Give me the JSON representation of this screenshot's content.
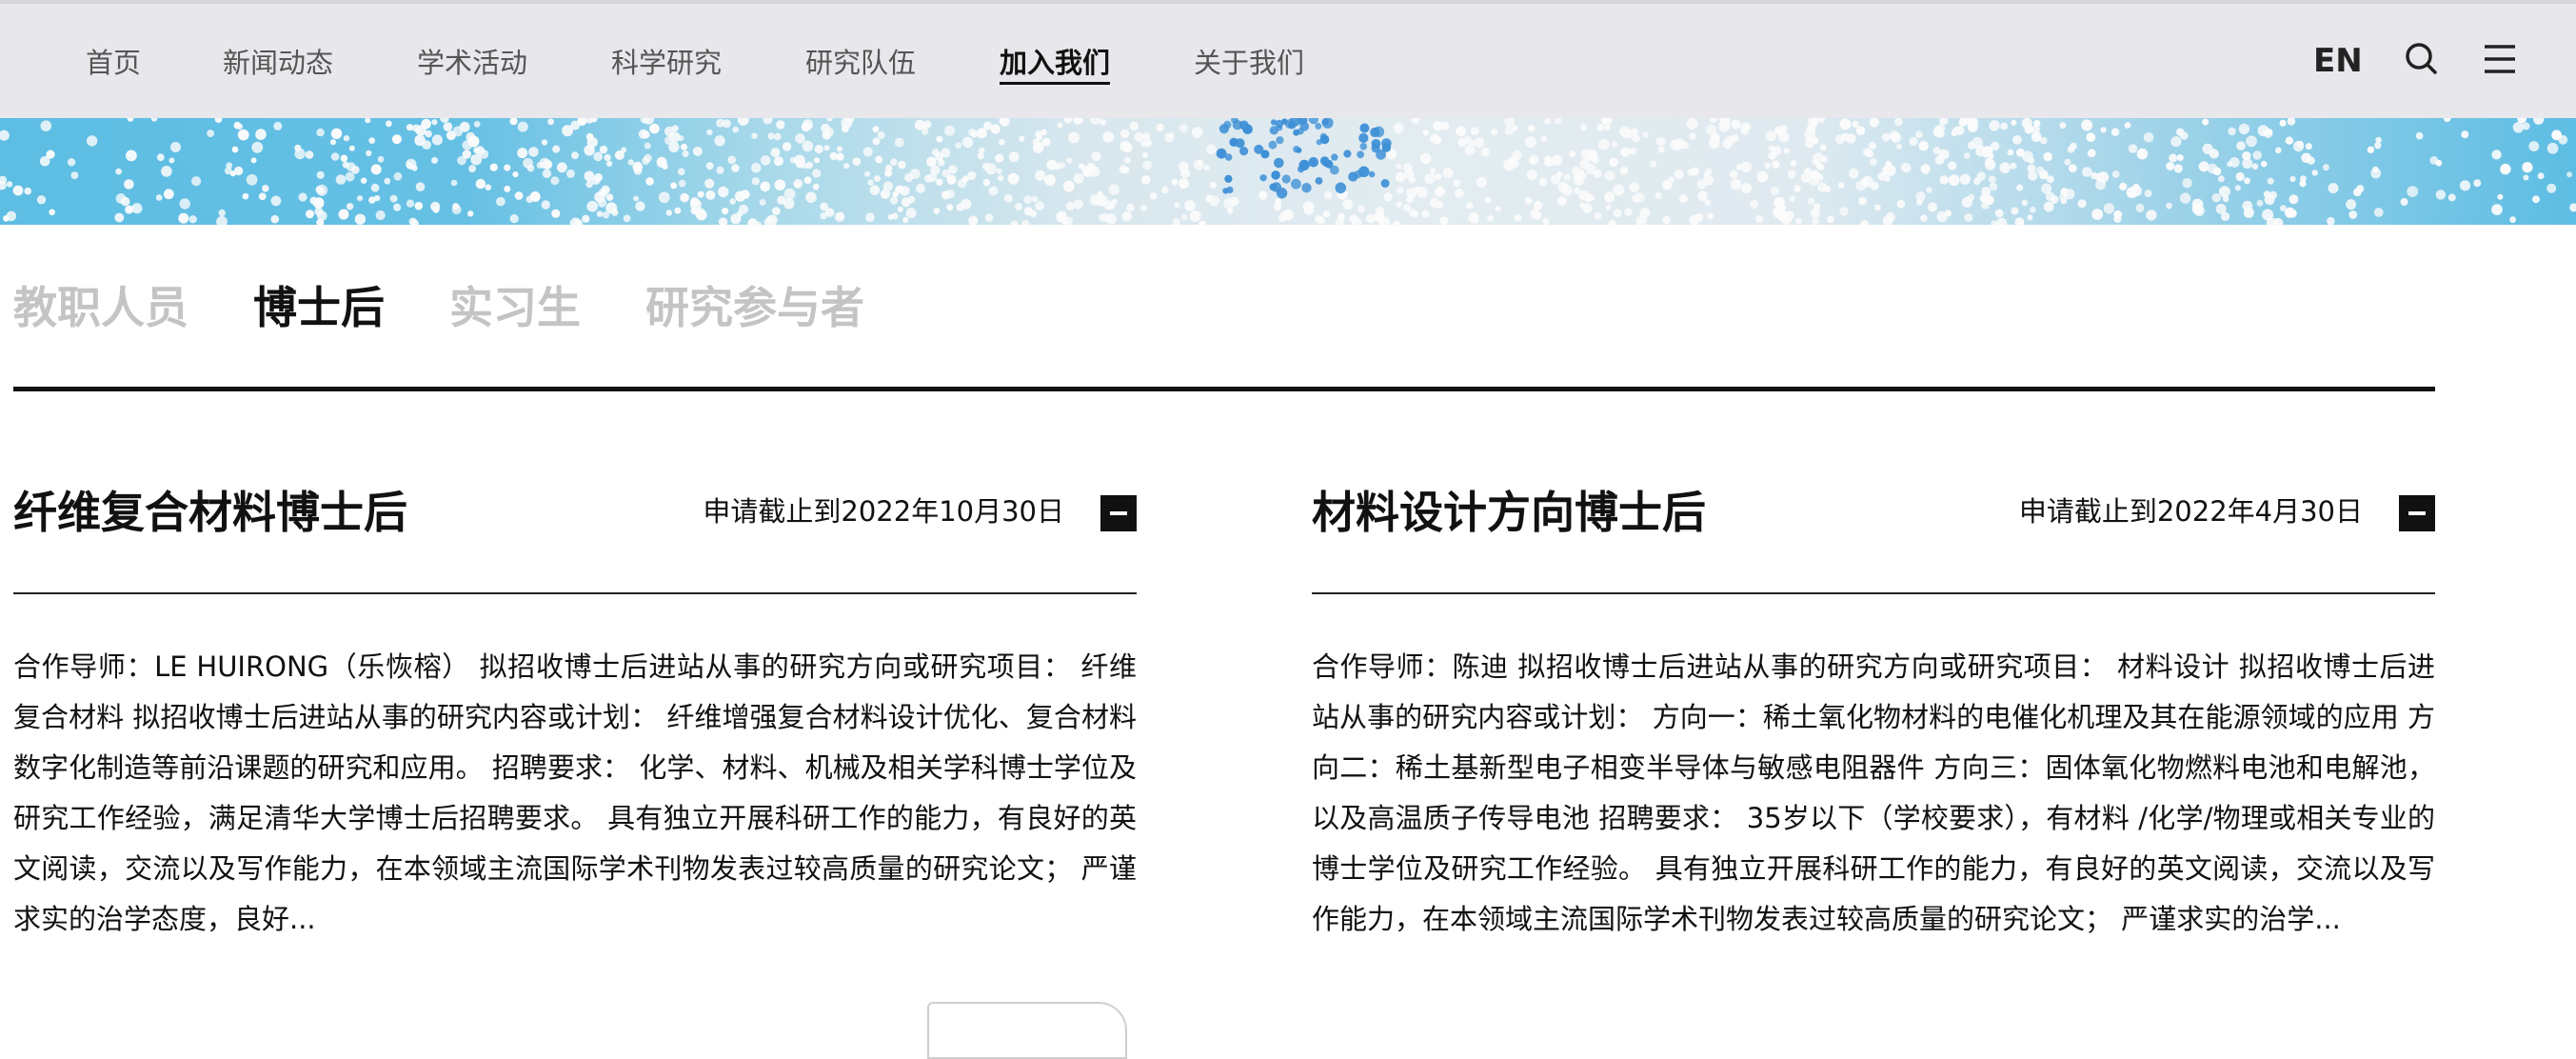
{
  "nav": {
    "items": [
      "首页",
      "新闻动态",
      "学术活动",
      "科学研究",
      "研究队伍",
      "加入我们",
      "关于我们"
    ],
    "active": "加入我们",
    "lang": "EN",
    "icons": [
      "search-icon",
      "menu-icon"
    ]
  },
  "categories": {
    "items": [
      "教职人员",
      "博士后",
      "实习生",
      "研究参与者"
    ],
    "active": "博士后"
  },
  "jobs": [
    {
      "title": "纤维复合材料博士后",
      "deadline": "申请截止到2022年10月30日",
      "description": "合作导师：LE HUIRONG（乐恢榕） 拟招收博士后进站从事的研究方向或研究项目： 纤维复合材料 拟招收博士后进站从事的研究内容或计划： 纤维增强复合材料设计优化、复合材料数字化制造等前沿课题的研究和应用。 招聘要求： 化学、材料、机械及相关学科博士学位及研究工作经验，满足清华大学博士后招聘要求。 具有独立开展科研工作的能力，有良好的英文阅读，交流以及写作能力，在本领域主流国际学术刊物发表过较高质量的研究论文； 严谨求实的治学态度，良好..."
    },
    {
      "title": "材料设计方向博士后",
      "deadline": "申请截止到2022年4月30日",
      "description": "合作导师：陈迪 拟招收博士后进站从事的研究方向或研究项目： 材料设计 拟招收博士后进站从事的研究内容或计划： 方向一：稀土氧化物材料的电催化机理及其在能源领域的应用 方向二：稀土基新型电子相变半导体与敏感电阻器件 方向三：固体氧化物燃料电池和电解池，以及高温质子传导电池 招聘要求： 35岁以下（学校要求），有材料 /化学/物理或相关专业的博士学位及研究工作经验。 具有独立开展科研工作的能力，有良好的英文阅读，交流以及写作能力，在本领域主流国际学术刊物发表过较高质量的研究论文； 严谨求实的治学..."
    }
  ],
  "colors": {
    "nav_bg": "#e8e8ec",
    "active_text": "#111111",
    "inactive_tab": "#c4c4c4",
    "banner_blue": "#5dbde3"
  }
}
